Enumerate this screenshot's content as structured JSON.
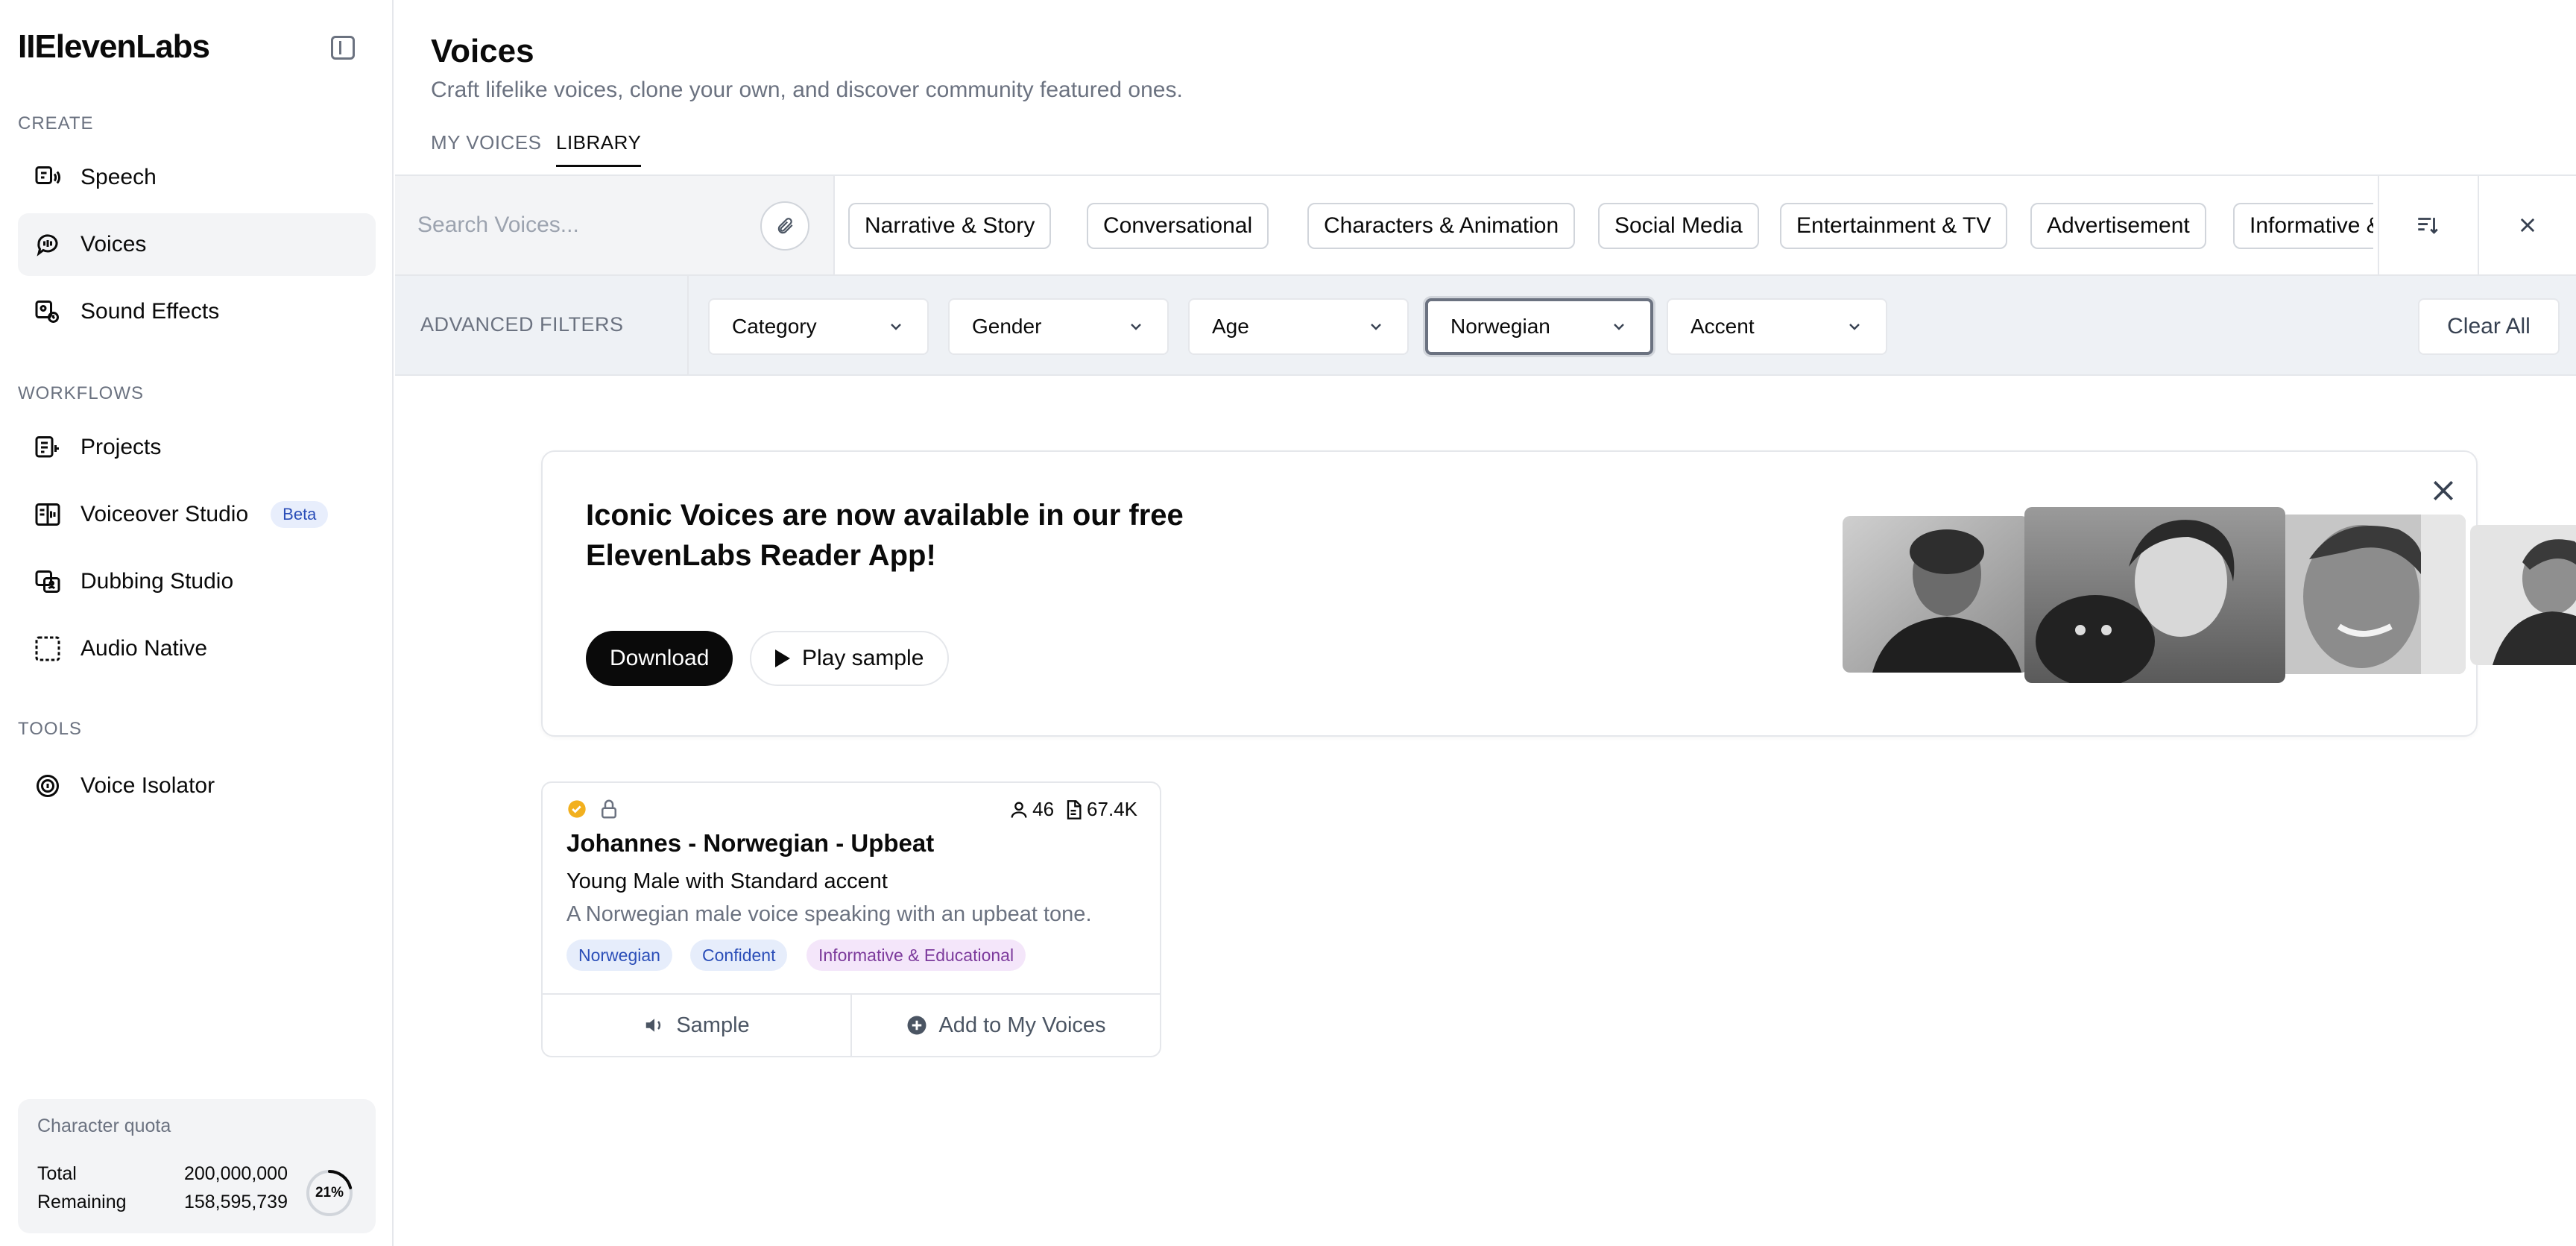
{
  "app": {
    "logo": "IIElevenLabs"
  },
  "sidebar": {
    "sections": {
      "create": "CREATE",
      "workflows": "WORKFLOWS",
      "tools": "TOOLS"
    },
    "items": [
      {
        "label": "Speech",
        "icon": "speech-icon",
        "active": false
      },
      {
        "label": "Voices",
        "icon": "voices-icon",
        "active": true
      },
      {
        "label": "Sound Effects",
        "icon": "sound-effects-icon",
        "active": false
      },
      {
        "label": "Projects",
        "icon": "projects-icon",
        "active": false
      },
      {
        "label": "Voiceover Studio",
        "icon": "voiceover-studio-icon",
        "badge": "Beta",
        "active": false
      },
      {
        "label": "Dubbing Studio",
        "icon": "dubbing-studio-icon",
        "active": false
      },
      {
        "label": "Audio Native",
        "icon": "audio-native-icon",
        "active": false
      },
      {
        "label": "Voice Isolator",
        "icon": "voice-isolator-icon",
        "active": false
      }
    ],
    "quota": {
      "title": "Character quota",
      "total_label": "Total",
      "total_value": "200,000,000",
      "remaining_label": "Remaining",
      "remaining_value": "158,595,739",
      "percent_label": "21%",
      "percent": 21
    }
  },
  "header": {
    "title": "Voices",
    "subtitle": "Craft lifelike voices, clone your own, and discover community featured ones.",
    "tabs": [
      {
        "label": "MY VOICES",
        "active": false
      },
      {
        "label": "LIBRARY",
        "active": true
      }
    ]
  },
  "search": {
    "placeholder": "Search Voices...",
    "chips": [
      "Narrative & Story",
      "Conversational",
      "Characters & Animation",
      "Social Media",
      "Entertainment & TV",
      "Advertisement",
      "Informative & Educational"
    ]
  },
  "filters": {
    "label": "ADVANCED FILTERS",
    "selects": [
      {
        "value": "Category",
        "focused": false
      },
      {
        "value": "Gender",
        "focused": false
      },
      {
        "value": "Age",
        "focused": false
      },
      {
        "value": "Norwegian",
        "focused": true
      },
      {
        "value": "Accent",
        "focused": false
      }
    ],
    "clear_all": "Clear All"
  },
  "banner": {
    "title": "Iconic Voices are now available in our free ElevenLabs Reader App!",
    "download_label": "Download",
    "play_label": "Play sample"
  },
  "voice_card": {
    "name": "Johannes - Norwegian - Upbeat",
    "subtitle": "Young Male with Standard accent",
    "description": "A Norwegian male voice speaking with an upbeat tone.",
    "users": "46",
    "characters": "67.4K",
    "tags": [
      "Norwegian",
      "Confident",
      "Informative & Educational"
    ],
    "sample_label": "Sample",
    "add_label": "Add to My Voices"
  },
  "colors": {
    "accent_dark": "#0a0a0a",
    "tag_blue_bg": "#e6edfb",
    "tag_purple_bg": "#f4e6fa",
    "verified": "#f2b01e"
  }
}
